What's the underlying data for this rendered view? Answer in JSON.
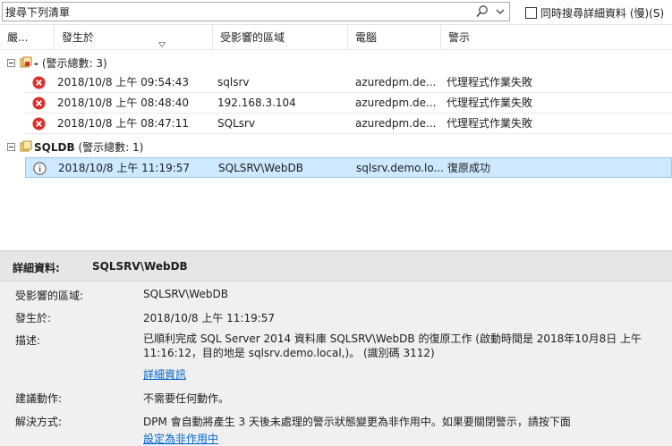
{
  "search": {
    "placeholder": "搜尋下列清單",
    "value": "搜尋下列清單",
    "detail_label": "同時搜尋詳細資料 (慢)(S)"
  },
  "columns": {
    "severity": "嚴...",
    "occurred": "發生於",
    "affected": "受影響的區域",
    "computer": "電腦",
    "alert": "警示"
  },
  "groups": [
    {
      "name": "-",
      "count_text": "(警示總數: 3)",
      "alerts": [
        {
          "severity": "error",
          "occurred": "2018/10/8 上午 09:54:43",
          "affected": "sqlsrv",
          "computer": "azuredpm.de...",
          "alert": "代理程式作業失敗"
        },
        {
          "severity": "error",
          "occurred": "2018/10/8 上午 08:48:40",
          "affected": "192.168.3.104",
          "computer": "azuredpm.de...",
          "alert": "代理程式作業失敗"
        },
        {
          "severity": "error",
          "occurred": "2018/10/8 上午 08:47:11",
          "affected": "SQLsrv",
          "computer": "azuredpm.de...",
          "alert": "代理程式作業失敗"
        }
      ]
    },
    {
      "name": "SQLDB",
      "count_text": "(警示總數: 1)",
      "alerts": [
        {
          "severity": "info",
          "occurred": "2018/10/8 上午 11:19:57",
          "affected": "SQLSRV\\WebDB",
          "computer": "sqlsrv.demo.lo...",
          "alert": "復原成功"
        }
      ]
    }
  ],
  "details": {
    "header_label": "詳細資料:",
    "header_value": "SQLSRV\\WebDB",
    "affected_label": "受影響的區域:",
    "affected_value": "SQLSRV\\WebDB",
    "occurred_label": "發生於:",
    "occurred_value": "2018/10/8 上午 11:19:57",
    "description_label": "描述:",
    "description_value": "已順利完成 SQL Server 2014 資料庫 SQLSRV\\WebDB 的復原工作 (啟動時間是 2018年10月8日 上午 11:16:12，目的地是 sqlsrv.demo.local,)。 (識別碼 3112)",
    "more_link": "詳細資訊",
    "action_label": "建議動作:",
    "action_value": "不需要任何動作。",
    "resolution_label": "解決方式:",
    "resolution_value": "DPM 會自動將產生 3 天後未處理的警示狀態變更為非作用中。如果要關閉警示，請按下面",
    "inactive_link": "設定為非作用中"
  },
  "colors": {
    "selected_row": "#cde8ff",
    "error_icon": "#d9302c",
    "info_icon": "#5a5a5a",
    "link": "#0066cc"
  },
  "icons": {
    "search": "search-icon",
    "dropdown": "chevron-down-icon",
    "error": "error-icon",
    "info": "info-icon",
    "group": "alert-group-icon"
  }
}
